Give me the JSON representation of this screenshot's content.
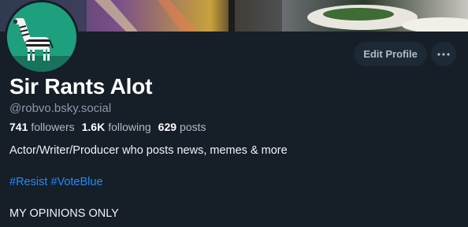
{
  "profile": {
    "display_name": "Sir Rants Alot",
    "handle": "@robvo.bsky.social",
    "followers_count": "741",
    "followers_label": "followers",
    "following_count": "1.6K",
    "following_label": "following",
    "posts_count": "629",
    "posts_label": "posts",
    "bio_line_1": "Actor/Writer/Producer who posts news, memes & more",
    "hashtags": [
      "#Resist",
      "#VoteBlue"
    ],
    "bio_line_3": "MY OPINIONS ONLY"
  },
  "actions": {
    "edit_profile_label": "Edit Profile",
    "more_icon": "ellipsis-icon"
  },
  "colors": {
    "background": "#161e27",
    "button_bg": "#1e2936",
    "link": "#208bfe",
    "avatar_bg": "#1e9f7e"
  }
}
